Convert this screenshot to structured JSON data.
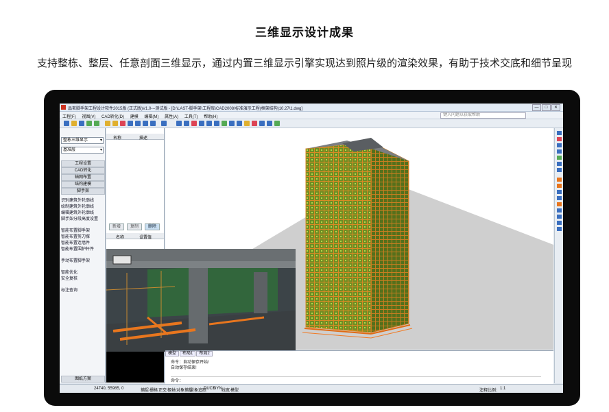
{
  "page": {
    "heading": "三维显示设计成果",
    "description": "支持整栋、整层、任意剖面三维显示，通过内置三维显示引擎实现达到照片级的渲染效果，有助于技术交底和细节呈现"
  },
  "app": {
    "title": "品茗脚手架工程设计软件2015版 (正式版)V1.0---测试版 - [D:\\LAST-脚手架\\工程库\\CAD2008\\标准演示工程(框架结构)10.27\\1.dwg]",
    "window_buttons": [
      "—",
      "□",
      "✕"
    ],
    "menu": [
      "工程(F)",
      "视图(V)",
      "CAD转化(D)",
      "建模",
      "编辑(M)",
      "属性(A)",
      "工具(T)",
      "帮助(H)"
    ],
    "help_search_placeholder": "键入问题以获取帮助",
    "accent_color": "#cc3322"
  },
  "left_panel": {
    "view_combo": "整栋三维显示",
    "floor_combo": "基准层",
    "categories": [
      "工程设置",
      "CAD转化",
      "轴网布置",
      "结构建模",
      "脚手架"
    ],
    "commands_group1": [
      "识别建筑外轮廓线",
      "绘制建筑外轮廓线",
      "编辑建筑外轮廓线",
      "脚手架分段高度设置"
    ],
    "commands_group2": [
      "智能布置脚手架",
      "智能布置剪刀撑",
      "智能布置连墙件",
      "智能布置围护杆件"
    ],
    "commands_group3": [
      "手动布置脚手架"
    ],
    "commands_group4": [
      "智能优化",
      "安全复核"
    ],
    "commands_group5": [
      "标注查询"
    ],
    "bottom_button": "图纸方案"
  },
  "mid_panel": {
    "col1": "名称",
    "col2": "描述",
    "buttons": [
      "新增",
      "复制",
      "删除"
    ],
    "prop_col1": "名称",
    "prop_col2": "设置值"
  },
  "command_area": {
    "tabs": [
      "模型",
      "布局1",
      "布局2"
    ],
    "lines": [
      "命令：自动保存开始!",
      "自动保存结束!",
      "命令："
    ]
  },
  "status_bar": {
    "coords": "24740, 55985, 0",
    "toggles": [
      "捕捉",
      "栅格",
      "正交",
      "极轴",
      "对象捕捉",
      "对象追踪",
      "DUCS",
      "DYN",
      "线宽",
      "模型"
    ],
    "scale_label": "注释比例：",
    "scale_value": "1:1"
  }
}
